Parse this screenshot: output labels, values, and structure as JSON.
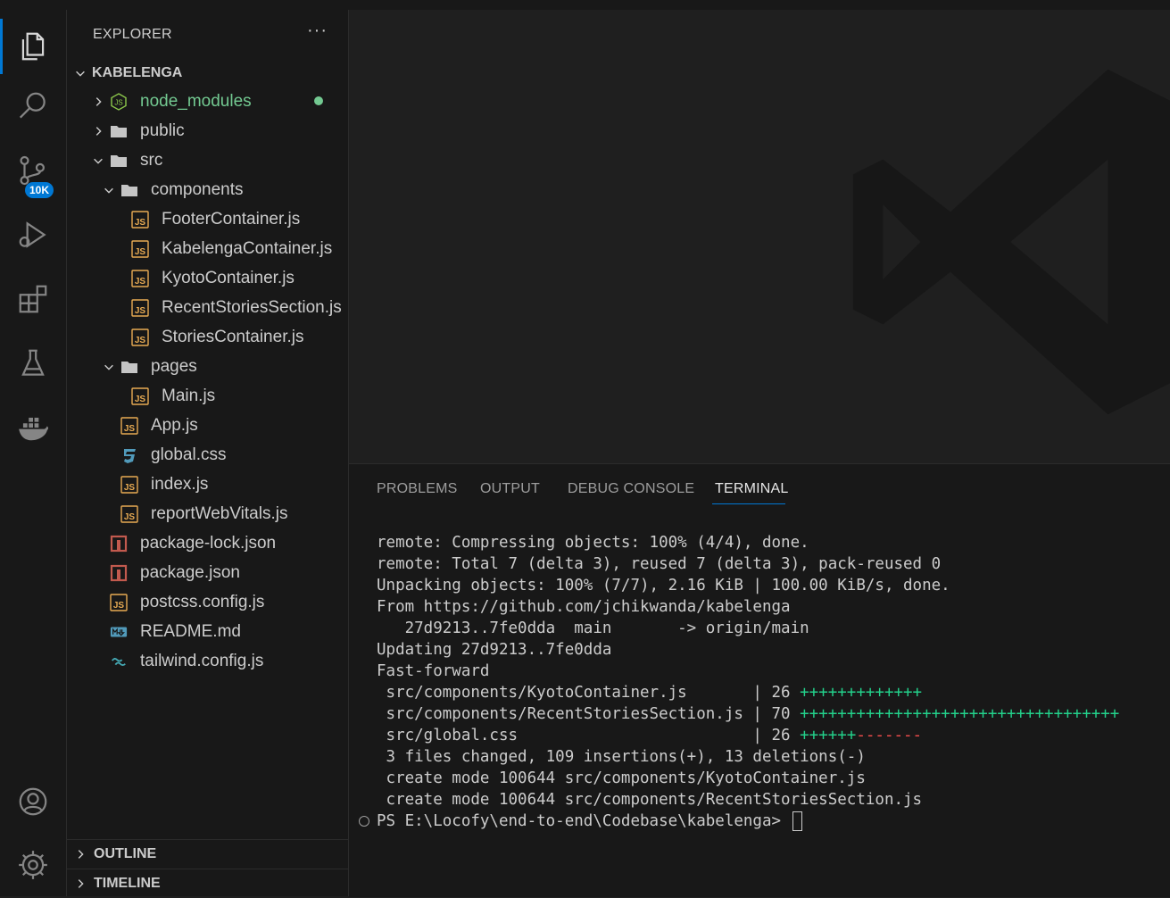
{
  "sidebar": {
    "title": "EXPLORER",
    "more": "···",
    "root_name": "KABELENGA",
    "tree": [
      {
        "label": "node_modules",
        "icon": "nodejs-folder-icon",
        "chevron": "right",
        "depth": 0,
        "color": "#73c991",
        "modified": true
      },
      {
        "label": "public",
        "icon": "folder-icon",
        "chevron": "right",
        "depth": 0
      },
      {
        "label": "src",
        "icon": "folder-icon",
        "chevron": "down",
        "depth": 0
      },
      {
        "label": "components",
        "icon": "folder-icon",
        "chevron": "down",
        "depth": 1
      },
      {
        "label": "FooterContainer.js",
        "icon": "js-file-icon",
        "depth": 2
      },
      {
        "label": "KabelengaContainer.js",
        "icon": "js-file-icon",
        "depth": 2
      },
      {
        "label": "KyotoContainer.js",
        "icon": "js-file-icon",
        "depth": 2
      },
      {
        "label": "RecentStoriesSection.js",
        "icon": "js-file-icon",
        "depth": 2
      },
      {
        "label": "StoriesContainer.js",
        "icon": "js-file-icon",
        "depth": 2
      },
      {
        "label": "pages",
        "icon": "folder-icon",
        "chevron": "down",
        "depth": 1
      },
      {
        "label": "Main.js",
        "icon": "js-file-icon",
        "depth": 2
      },
      {
        "label": "App.js",
        "icon": "js-file-icon",
        "depth": 1
      },
      {
        "label": "global.css",
        "icon": "css-file-icon",
        "depth": 1
      },
      {
        "label": "index.js",
        "icon": "js-file-icon",
        "depth": 1
      },
      {
        "label": "reportWebVitals.js",
        "icon": "js-file-icon",
        "depth": 1
      },
      {
        "label": "package-lock.json",
        "icon": "npm-file-icon",
        "depth": 0
      },
      {
        "label": "package.json",
        "icon": "npm-file-icon",
        "depth": 0
      },
      {
        "label": "postcss.config.js",
        "icon": "js-file-icon",
        "depth": 0
      },
      {
        "label": "README.md",
        "icon": "markdown-file-icon",
        "depth": 0
      },
      {
        "label": "tailwind.config.js",
        "icon": "tailwind-file-icon",
        "depth": 0
      }
    ],
    "sections": [
      {
        "label": "OUTLINE"
      },
      {
        "label": "TIMELINE"
      }
    ]
  },
  "activity_bar": {
    "items": [
      {
        "name": "explorer-icon",
        "active": true
      },
      {
        "name": "search-icon"
      },
      {
        "name": "source-control-icon",
        "badge": "10K"
      },
      {
        "name": "run-debug-icon"
      },
      {
        "name": "extensions-icon"
      },
      {
        "name": "testing-icon"
      },
      {
        "name": "docker-icon"
      }
    ],
    "bottom": [
      {
        "name": "account-icon"
      },
      {
        "name": "settings-gear-icon"
      }
    ]
  },
  "panel": {
    "tabs": [
      {
        "label": "PROBLEMS"
      },
      {
        "label": "OUTPUT"
      },
      {
        "label": "DEBUG CONSOLE"
      },
      {
        "label": "TERMINAL",
        "active": true
      }
    ],
    "terminal_lines": [
      "remote: Compressing objects: 100% (4/4), done.",
      "remote: Total 7 (delta 3), reused 7 (delta 3), pack-reused 0",
      "Unpacking objects: 100% (7/7), 2.16 KiB | 100.00 KiB/s, done.",
      "From https://github.com/jchikwanda/kabelenga",
      "   27d9213..7fe0dda  main       -> origin/main",
      "Updating 27d9213..7fe0dda",
      "Fast-forward",
      {
        "prefix": " src/components/KyotoContainer.js       | 26 ",
        "plus": "+++++++++++++",
        "minus": ""
      },
      {
        "prefix": " src/components/RecentStoriesSection.js | 70 ",
        "plus": "++++++++++++++++++++++++++++++++++",
        "minus": ""
      },
      {
        "prefix": " src/global.css                         | 26 ",
        "plus": "++++++",
        "minus": "-------"
      },
      " 3 files changed, 109 insertions(+), 13 deletions(-)",
      " create mode 100644 src/components/KyotoContainer.js",
      " create mode 100644 src/components/RecentStoriesSection.js"
    ],
    "prompt": "PS E:\\Locofy\\end-to-end\\Codebase\\kabelenga> "
  },
  "colors": {
    "accent": "#0078d4",
    "js_icon": "#e8ab53",
    "npm_icon": "#c25a4e",
    "css_icon": "#519aba",
    "diff_plus": "#23d18b",
    "diff_minus": "#f14c4c"
  }
}
